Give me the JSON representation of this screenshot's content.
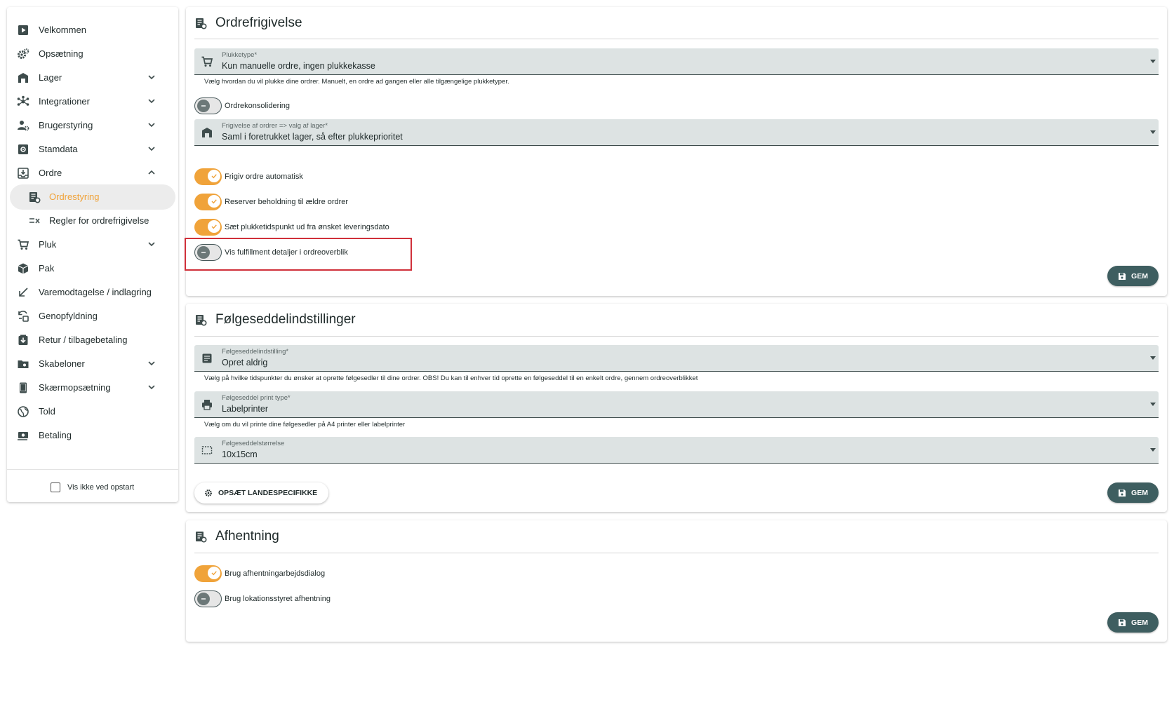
{
  "sidebar": {
    "items": [
      {
        "label": "Velkommen",
        "icon": "play-box-icon"
      },
      {
        "label": "Opsætning",
        "icon": "cogs-icon"
      },
      {
        "label": "Lager",
        "icon": "warehouse-icon"
      },
      {
        "label": "Integrationer",
        "icon": "hub-icon"
      },
      {
        "label": "Brugerstyring",
        "icon": "user-cog-icon"
      },
      {
        "label": "Stamdata",
        "icon": "database-cog-icon"
      },
      {
        "label": "Ordre",
        "icon": "inbox-icon"
      },
      {
        "label": "Ordrestyring",
        "icon": "receipt-gear-icon"
      },
      {
        "label": "Regler for ordrefrigivelse",
        "icon": "rule-list-icon"
      },
      {
        "label": "Pluk",
        "icon": "cart-icon"
      },
      {
        "label": "Pak",
        "icon": "package-icon"
      },
      {
        "label": "Varemodtagelse / indlagring",
        "icon": "arrow-down-left-icon"
      },
      {
        "label": "Genopfyldning",
        "icon": "refill-icon"
      },
      {
        "label": "Retur / tilbagebetaling",
        "icon": "return-box-icon"
      },
      {
        "label": "Skabeloner",
        "icon": "folder-icon"
      },
      {
        "label": "Skærmopsætning",
        "icon": "tablet-icon"
      },
      {
        "label": "Told",
        "icon": "globe-icon"
      },
      {
        "label": "Betaling",
        "icon": "cash-icon"
      }
    ],
    "startup_label": "Vis ikke ved opstart"
  },
  "ordrefrigivelse": {
    "title": "Ordrefrigivelse",
    "plukketype": {
      "label": "Plukketype*",
      "value": "Kun manuelle ordre, ingen plukkekasse",
      "helper": "Vælg hvordan du vil plukke dine ordrer. Manuelt, en ordre ad gangen eller alle tilgængelige plukketyper."
    },
    "ordrekonsolidering": {
      "label": "Ordrekonsolidering",
      "state": "off"
    },
    "frigivelse": {
      "label": "Frigivelse af ordrer => valg af lager*",
      "value": "Saml i foretrukket lager, så efter plukkeprioritet"
    },
    "toggles": [
      {
        "label": "Frigiv ordre automatisk",
        "state": "on"
      },
      {
        "label": "Reserver beholdning til ældre ordrer",
        "state": "on"
      },
      {
        "label": "Sæt plukketidspunkt ud fra ønsket leveringsdato",
        "state": "on"
      },
      {
        "label": "Vis fulfillment detaljer i ordreoverblik",
        "state": "off"
      }
    ],
    "save_label": "GEM"
  },
  "folgeseddel": {
    "title": "Følgeseddelindstillinger",
    "indstilling": {
      "label": "Følgeseddelindstilling*",
      "value": "Opret aldrig",
      "helper": "Vælg på hvilke tidspunkter du ønsker at oprette følgesedler til dine ordrer. OBS! Du kan til enhver tid oprette en følgeseddel til en enkelt ordre, gennem ordreoverblikket"
    },
    "printtype": {
      "label": "Følgeseddel print type*",
      "value": "Labelprinter",
      "helper": "Vælg om du vil printe dine følgesedler på A4 printer eller labelprinter"
    },
    "storrelse": {
      "label": "Følgeseddelstørrelse",
      "value": "10x15cm"
    },
    "country_button_label": "OPSÆT LANDESPECIFIKKE",
    "save_label": "GEM"
  },
  "afhentning": {
    "title": "Afhentning",
    "toggles": [
      {
        "label": "Brug afhentningarbejdsdialog",
        "state": "on"
      },
      {
        "label": "Brug lokationsstyret afhentning",
        "state": "off"
      }
    ],
    "save_label": "GEM"
  },
  "colors": {
    "accent": "#f0a33a",
    "primary": "#3e5e60",
    "field_bg": "#dde3e3",
    "highlight": "#d0303a"
  }
}
